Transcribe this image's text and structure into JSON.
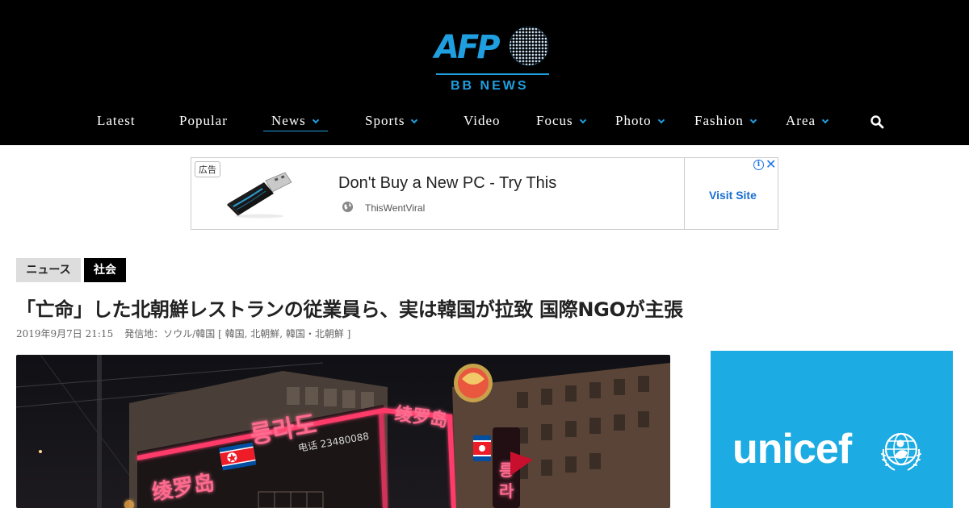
{
  "header": {
    "logo": {
      "brand": "AFP",
      "sub": "BB NEWS"
    },
    "nav": [
      {
        "label": "Latest",
        "dropdown": false
      },
      {
        "label": "Popular",
        "dropdown": false
      },
      {
        "label": "News",
        "dropdown": true,
        "active": true
      },
      {
        "label": "Sports",
        "dropdown": true
      },
      {
        "label": "Video",
        "dropdown": false
      },
      {
        "label": "Focus",
        "dropdown": true
      },
      {
        "label": "Photo",
        "dropdown": true
      },
      {
        "label": "Fashion",
        "dropdown": true
      },
      {
        "label": "Area",
        "dropdown": true
      }
    ],
    "search_icon": "search-icon"
  },
  "ad": {
    "badge": "広告",
    "title": "Don't Buy a New PC - Try This",
    "source": "ThisWentViral",
    "cta": "Visit Site",
    "info": "i",
    "close": "✕"
  },
  "article": {
    "tags": [
      "ニュース",
      "社会"
    ],
    "headline": "「亡命」した北朝鮮レストランの従業員ら、実は韓国が拉致 国際NGOが主張",
    "date": "2019年9月7日 21:15",
    "location": "発信地：ソウル/韓国 [ 韓国, 北朝鮮, 韓国・北朝鮮 ]",
    "photo_signs": {
      "hanja": "绫罗岛",
      "hangul": "릉라도",
      "phone": "电话 23480088"
    }
  },
  "sidebar_ad": {
    "brand": "unicef"
  },
  "colors": {
    "accent": "#1f9fe0",
    "header_bg": "#000000",
    "unicef": "#1cabe2",
    "ad_link": "#1a6fd0"
  }
}
